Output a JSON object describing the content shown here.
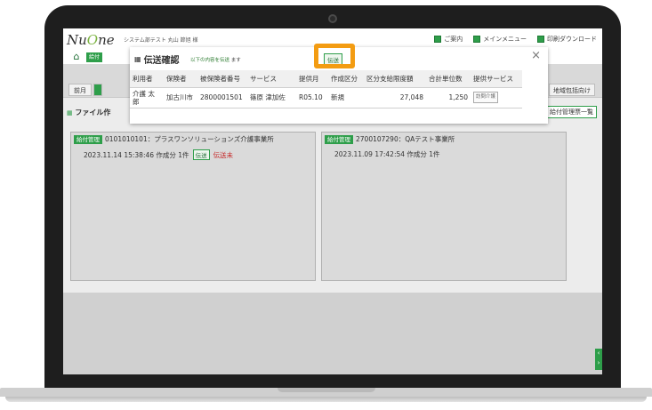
{
  "app": {
    "logo_text": "NuOne",
    "user_info": "システム部テスト 丸山 節旭 様",
    "top_nav": [
      "ご案内",
      "メインメニュー",
      "印刷ダウンロード"
    ],
    "kyufu_tab": "給付",
    "home_icon": "home-icon"
  },
  "sub_tabs": [
    "前月",
    "当"
  ],
  "region_tab": "地域包括向け",
  "file_panel": {
    "title": "ファイル作",
    "list_button": "給付管理票一覧"
  },
  "cards": [
    {
      "tag": "給付管理",
      "heading": "0101010101：プラスワンソリューションズ介護事業所",
      "line": "2023.11.14 15:38:46 作成分 1件",
      "send_label": "伝送",
      "status": "伝送未"
    },
    {
      "tag": "給付管理",
      "heading": "2700107290：QAテスト事業所",
      "line": "2023.11.09 17:42:54 作成分 1件"
    }
  ],
  "dialog": {
    "title": "伝送確認",
    "subtitle_pre": "以下の内容を伝送",
    "subtitle_post": "ます",
    "send_button": "伝送",
    "close": "×",
    "columns": [
      "利用者",
      "保険者",
      "被保険者番号",
      "サービス",
      "提供月",
      "作成区分",
      "区分支給限度額",
      "合計単位数",
      "提供サービス"
    ],
    "row": {
      "user": "介護 太郎",
      "insurer": "加古川市",
      "insured_no": "2800001501",
      "service": "篠原 津加佐",
      "month": "R05.10",
      "category": "新規",
      "limit": "27,048",
      "units": "1,250",
      "service_badge": "訪問介護"
    }
  },
  "colors": {
    "accent_green": "#2e9e4a",
    "highlight_orange": "#f39c12",
    "unsent_red": "#c62828"
  }
}
